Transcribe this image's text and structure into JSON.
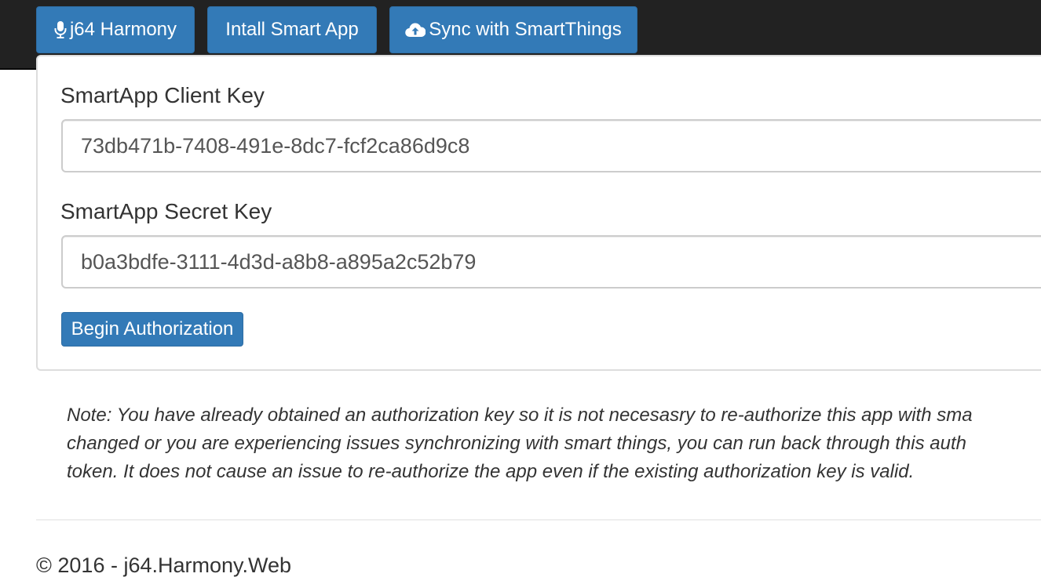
{
  "navbar": {
    "buttons": [
      {
        "label": "j64 Harmony",
        "icon": "microphone-icon"
      },
      {
        "label": "Intall Smart App",
        "icon": ""
      },
      {
        "label": "Sync with SmartThings",
        "icon": "cloud-upload-icon"
      }
    ]
  },
  "form": {
    "client_key": {
      "label": "SmartApp Client Key",
      "value": "73db471b-7408-491e-8dc7-fcf2ca86d9c8"
    },
    "secret_key": {
      "label": "SmartApp Secret Key",
      "value": "b0a3bdfe-3111-4d3d-a8b8-a895a2c52b79"
    },
    "submit_label": "Begin Authorization"
  },
  "note": {
    "lines": [
      "Note: You have already obtained an authorization key so it is not necesasry to re-authorize this app with sma",
      "changed or you are experiencing issues synchronizing with smart things, you can run back through this auth",
      "token. It does not cause an issue to re-authorize the app even if the existing authorization key is valid."
    ]
  },
  "footer": {
    "text": "© 2016 - j64.Harmony.Web"
  },
  "colors": {
    "primary": "#337ab7",
    "navbar": "#222222"
  }
}
